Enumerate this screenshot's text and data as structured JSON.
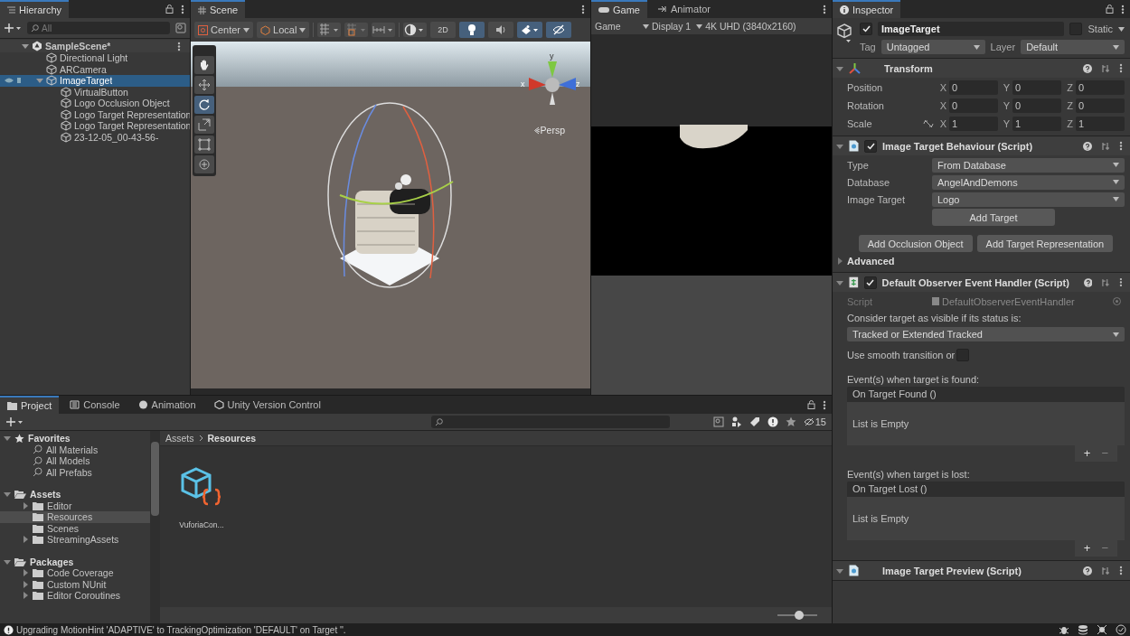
{
  "hierarchy": {
    "title": "Hierarchy",
    "search": {
      "placeholder": "All"
    },
    "tree": [
      {
        "name": "SampleScene*",
        "kind": "scene",
        "selected": false,
        "expanded": true,
        "children": [
          {
            "name": "Directional Light",
            "kind": "object",
            "selected": false
          },
          {
            "name": "ARCamera",
            "kind": "object",
            "selected": false
          },
          {
            "name": "ImageTarget",
            "kind": "object",
            "selected": true,
            "expanded": true,
            "children": [
              {
                "name": "VirtualButton",
                "kind": "object",
                "selected": false
              },
              {
                "name": "Logo Occlusion Object",
                "kind": "object",
                "selected": false
              },
              {
                "name": "Logo Target Representation",
                "kind": "object",
                "selected": false
              },
              {
                "name": "Logo Target Representation",
                "kind": "object",
                "selected": false
              },
              {
                "name": "23-12-05_00-43-56-",
                "kind": "object",
                "selected": false
              }
            ]
          }
        ]
      }
    ]
  },
  "scene": {
    "title": "Scene",
    "pivot": "Center",
    "space": "Local",
    "mode_2d": "2D",
    "toggles": [
      {
        "kind": "light",
        "on": true
      },
      {
        "kind": "audio",
        "on": false
      },
      {
        "kind": "effects",
        "on": true
      },
      {
        "kind": "hidden",
        "on": true
      }
    ],
    "tools": [
      {
        "kind": "hand",
        "selected": false
      },
      {
        "kind": "move",
        "selected": false
      },
      {
        "kind": "rotate",
        "selected": true
      },
      {
        "kind": "scale",
        "selected": false
      },
      {
        "kind": "rect",
        "selected": false
      },
      {
        "kind": "transform",
        "selected": false
      }
    ],
    "projection": "Persp",
    "axes": [
      "x",
      "y",
      "z"
    ]
  },
  "game": {
    "tabs": [
      {
        "label": "Game",
        "kind": "game",
        "selected": true
      },
      {
        "label": "Animator",
        "kind": "animator",
        "selected": false
      }
    ],
    "mode": "Game",
    "display": "Display 1",
    "resolution": "4K UHD (3840x2160)"
  },
  "inspector": {
    "title": "Inspector",
    "object": {
      "active": true,
      "name": "ImageTarget",
      "static": false,
      "static_label": "Static",
      "tag_label": "Tag",
      "tag": "Untagged",
      "layer_label": "Layer",
      "layer": "Default"
    },
    "components": [
      {
        "kind": "transform",
        "title": "Transform",
        "expanded": true,
        "rows": [
          {
            "label": "Position",
            "link": false,
            "values": [
              {
                "axis": "X",
                "value": "0"
              },
              {
                "axis": "Y",
                "value": "0"
              },
              {
                "axis": "Z",
                "value": "0"
              }
            ]
          },
          {
            "label": "Rotation",
            "link": false,
            "values": [
              {
                "axis": "X",
                "value": "0"
              },
              {
                "axis": "Y",
                "value": "0"
              },
              {
                "axis": "Z",
                "value": "0"
              }
            ]
          },
          {
            "label": "Scale",
            "link": true,
            "values": [
              {
                "axis": "X",
                "value": "1"
              },
              {
                "axis": "Y",
                "value": "1"
              },
              {
                "axis": "Z",
                "value": "1"
              }
            ]
          }
        ]
      },
      {
        "kind": "behaviour",
        "title": "Image Target Behaviour (Script)",
        "expanded": true,
        "enabled": true,
        "fields": [
          {
            "label": "Type",
            "value": "From Database"
          },
          {
            "label": "Database",
            "value": "AngelAndDemons"
          },
          {
            "label": "Image Target",
            "value": "Logo"
          }
        ],
        "button": "Add Target",
        "buttons": [
          "Add Occlusion Object",
          "Add Target Representation"
        ],
        "advanced": {
          "label": "Advanced",
          "expanded": false
        }
      },
      {
        "kind": "observer",
        "title": "Default Observer Event Handler (Script)",
        "expanded": true,
        "enabled": true,
        "script": {
          "label": "Script",
          "value": "DefaultObserverEventHandler"
        },
        "status_label": "Consider target as visible if its status is:",
        "status": "Tracked or Extended Tracked",
        "smooth": {
          "label": "Use smooth transition or",
          "checked": false
        },
        "events": [
          {
            "label": "Event(s) when target is found:",
            "header": "On Target Found ()",
            "empty": "List is Empty",
            "add": "+",
            "remove": "−"
          },
          {
            "label": "Event(s) when target is lost:",
            "header": "On Target Lost ()",
            "empty": "List is Empty",
            "add": "+",
            "remove": "−"
          }
        ]
      },
      {
        "kind": "preview",
        "title": "Image Target Preview (Script)",
        "expanded": true
      }
    ]
  },
  "project": {
    "tabs": [
      {
        "label": "Project",
        "kind": "folder",
        "selected": true
      },
      {
        "label": "Console",
        "kind": "console",
        "selected": false
      },
      {
        "label": "Animation",
        "kind": "animation",
        "selected": false
      },
      {
        "label": "Unity Version Control",
        "kind": "vcs",
        "selected": false
      }
    ],
    "hidden_count": "15",
    "tree": [
      {
        "label": "Favorites",
        "kind": "star",
        "expanded": true,
        "selected": false,
        "children": [
          {
            "label": "All Materials",
            "kind": "search",
            "selected": false
          },
          {
            "label": "All Models",
            "kind": "search",
            "selected": false
          },
          {
            "label": "All Prefabs",
            "kind": "search",
            "selected": false
          }
        ]
      },
      {
        "label": "Assets",
        "kind": "openfolder",
        "expanded": true,
        "selected": false,
        "children": [
          {
            "label": "Editor",
            "kind": "folder",
            "expanded": false,
            "selected": false
          },
          {
            "label": "Resources",
            "kind": "folder",
            "selected": true
          },
          {
            "label": "Scenes",
            "kind": "folder",
            "selected": false
          },
          {
            "label": "StreamingAssets",
            "kind": "folder",
            "expanded": false,
            "selected": false
          }
        ]
      },
      {
        "label": "Packages",
        "kind": "openfolder",
        "expanded": true,
        "selected": false,
        "children": [
          {
            "label": "Code Coverage",
            "kind": "folder",
            "expanded": false,
            "selected": false
          },
          {
            "label": "Custom NUnit",
            "kind": "folder",
            "expanded": false,
            "selected": false
          },
          {
            "label": "Editor Coroutines",
            "kind": "folder",
            "expanded": false,
            "selected": false
          }
        ]
      }
    ],
    "breadcrumb": [
      "Assets",
      "Resources"
    ],
    "assets": [
      {
        "name": "VuforiaCon..."
      }
    ],
    "zoom": {
      "level": 0.55
    }
  },
  "status_bar": {
    "message": "Upgrading MotionHint 'ADAPTIVE' to TrackingOptimization 'DEFAULT' on Target ''."
  }
}
